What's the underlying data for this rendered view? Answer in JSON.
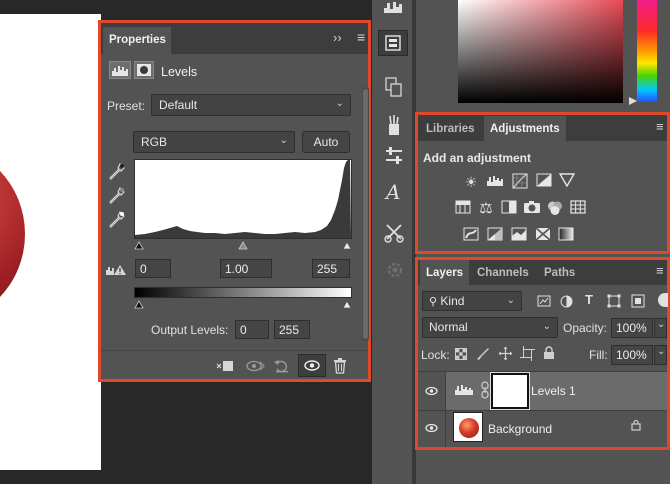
{
  "properties": {
    "tab_title": "Properties",
    "collapse_glyph": "››",
    "menu_glyph": "≡",
    "header_title": "Levels",
    "preset_label": "Preset:",
    "preset_value": "Default",
    "channel_value": "RGB",
    "auto_label": "Auto",
    "input_black": "0",
    "input_gamma": "1.00",
    "input_white": "255",
    "output_label": "Output Levels:",
    "output_black": "0",
    "output_white": "255"
  },
  "tabs_top": {
    "libraries": "Libraries",
    "adjustments": "Adjustments"
  },
  "adjustments": {
    "heading": "Add an adjustment",
    "row1": [
      "brightness-contrast-icon",
      "levels-icon",
      "curves-icon",
      "exposure-icon",
      "vibrance-icon"
    ],
    "row2": [
      "hue-saturation-icon",
      "color-balance-icon",
      "black-white-icon",
      "photo-filter-icon",
      "channel-mixer-icon",
      "color-lookup-icon"
    ],
    "row3": [
      "invert-icon",
      "posterize-icon",
      "threshold-icon",
      "selective-color-icon",
      "gradient-map-icon"
    ]
  },
  "layers_tabs": {
    "layers": "Layers",
    "channels": "Channels",
    "paths": "Paths"
  },
  "layers": {
    "filter_kind": "Kind",
    "blend_mode": "Normal",
    "opacity_label": "Opacity:",
    "opacity_value": "100%",
    "lock_label": "Lock:",
    "fill_label": "Fill:",
    "fill_value": "100%",
    "items": [
      {
        "name": "Levels 1",
        "selected": true
      },
      {
        "name": "Background",
        "selected": false
      }
    ]
  },
  "colors": {
    "highlight_border": "#e0482c",
    "panel_bg": "#535353",
    "tab_bar_bg": "#3d3d3d"
  }
}
